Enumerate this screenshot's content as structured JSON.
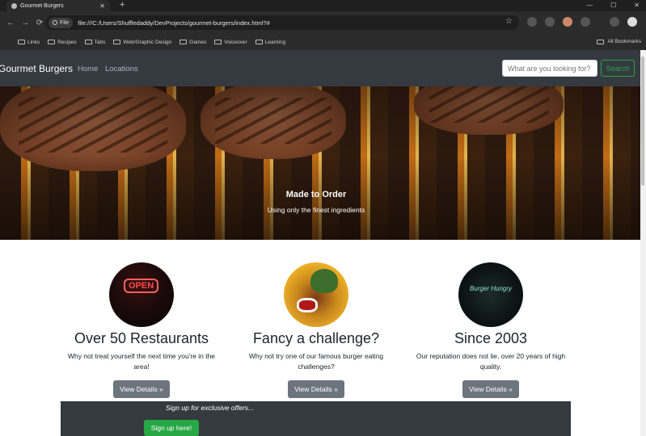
{
  "browser": {
    "tab_title": "Gourmet Burgers",
    "new_tab": "+",
    "win_min": "—",
    "win_max": "☐",
    "win_close": "✕",
    "tab_close": "✕",
    "back": "←",
    "forward": "→",
    "reload": "⟳",
    "file_chip": "File",
    "url": "file:///C:/Users/Shuffledaddy/DevProjects/gourmet-burgers/index.html?#",
    "star": "☆",
    "bookmarks": [
      "Links",
      "Recipes",
      "Tabs",
      "Web/Graphic Design",
      "Games",
      "Voiceover",
      "Learning"
    ],
    "all_bookmarks": "All Bookmarks"
  },
  "site_nav": {
    "brand": "Gourmet Burgers",
    "links": [
      "Home",
      "Locations"
    ],
    "search_placeholder": "What are you looking for?",
    "search_button": "Search"
  },
  "hero": {
    "title": "Made to Order",
    "subtitle": "Using only the finest ingredients"
  },
  "features": [
    {
      "title": "Over 50 Restaurants",
      "text": "Why not treat yourself the next time you're in the area!",
      "button": "View Details »",
      "image_text": "OPEN"
    },
    {
      "title": "Fancy a challenge?",
      "text": "Why not try one of our famous burger eating challenges?",
      "button": "View Details »"
    },
    {
      "title": "Since 2003",
      "text": "Our reputation does not lie, over 20 years of high quality.",
      "button": "View Details »",
      "image_text": "Burger Hungry"
    }
  ],
  "signup": {
    "text": "Sign up for exclusive offers...",
    "button": "Sign up here!"
  },
  "colors": {
    "navbar": "#343a40",
    "success": "#28a745",
    "secondary": "#6c757d"
  }
}
